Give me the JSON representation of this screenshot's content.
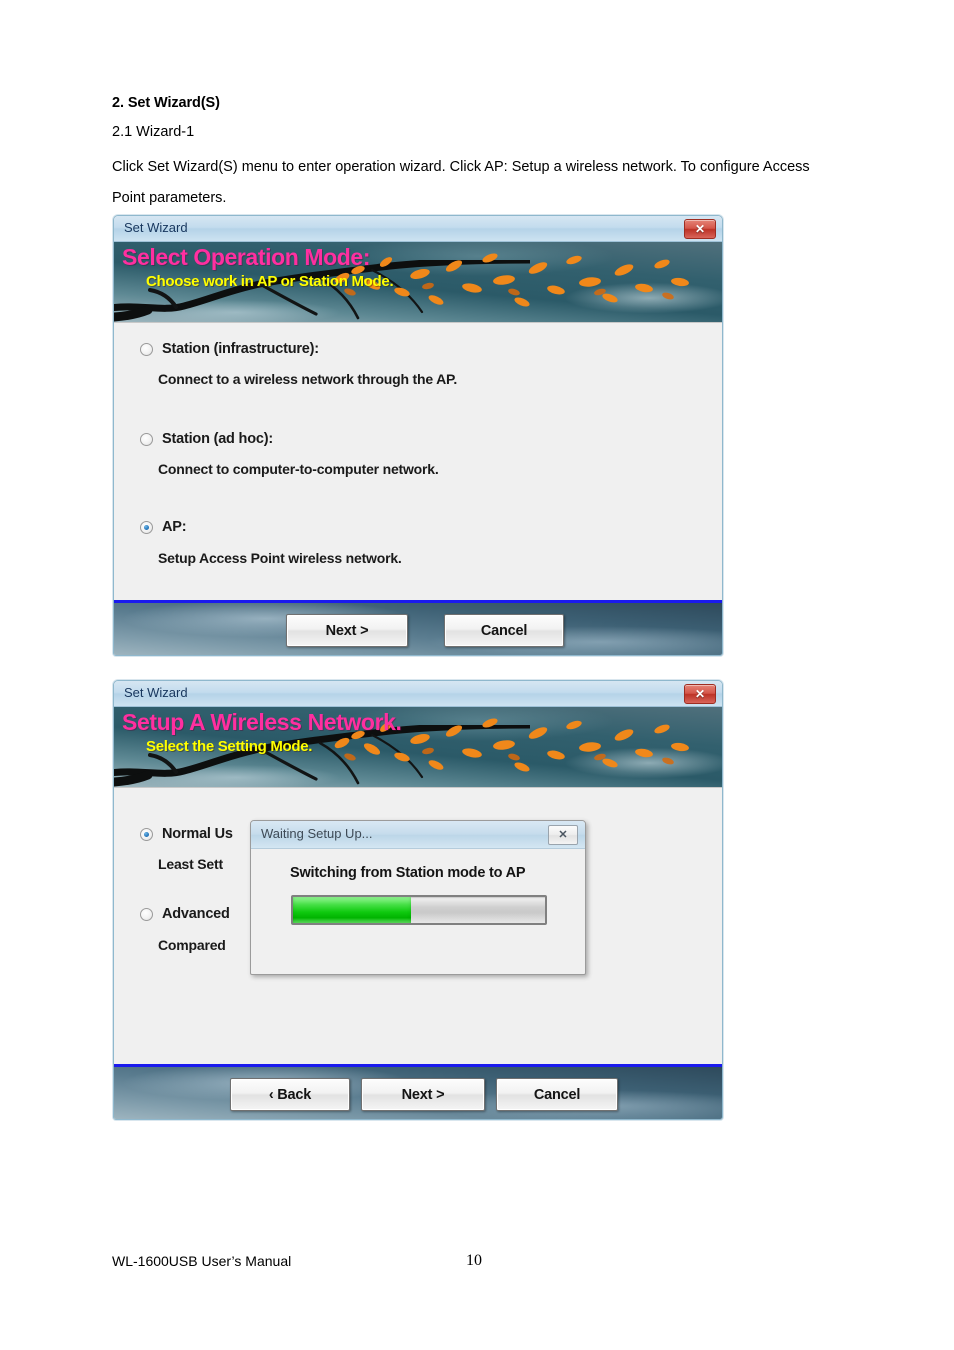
{
  "document": {
    "heading": "2. Set Wizard(S)",
    "subheading": "2.1 Wizard-1",
    "paragraph": "Click Set Wizard(S) menu to enter operation wizard. Click AP: Setup a wireless network. To configure Access Point parameters.",
    "footer_left": "WL-1600USB User’s Manual",
    "page_number": "10"
  },
  "colors": {
    "banner_title": "#ff2fa0",
    "banner_subtitle": "#ffff00",
    "titlebar_text": "#17365d",
    "progress_fill": "#0fc90f",
    "footer_rule": "#1a1aee",
    "close_red": "#bc3226"
  },
  "dialog1": {
    "title": "Set Wizard",
    "close_label": "✕",
    "banner": {
      "title": "Select Operation Mode:",
      "subtitle": "Choose work in AP or Station Mode."
    },
    "options": [
      {
        "label": "Station (infrastructure):",
        "description": "Connect to a wireless network through the AP.",
        "selected": false
      },
      {
        "label": "Station (ad hoc):",
        "description": "Connect to computer-to-computer network.",
        "selected": false
      },
      {
        "label": "AP:",
        "description": "Setup Access Point wireless network.",
        "selected": true
      }
    ],
    "buttons": [
      {
        "label": "Next >"
      },
      {
        "label": "Cancel"
      }
    ]
  },
  "dialog2": {
    "title": "Set Wizard",
    "close_label": "✕",
    "banner": {
      "title": "Setup A Wireless Network.",
      "subtitle": "Select the Setting Mode."
    },
    "options": [
      {
        "label": "Normal Us",
        "description": "Least Sett",
        "selected": true
      },
      {
        "label": "Advanced",
        "description": "Compared",
        "selected": false
      }
    ],
    "buttons": [
      {
        "label": "‹ Back"
      },
      {
        "label": "Next >"
      },
      {
        "label": "Cancel"
      }
    ]
  },
  "progress_dialog": {
    "title": "Waiting Setup Up...",
    "close_label": "✕",
    "message": "Switching from Station mode to AP",
    "progress_percent": 47
  }
}
